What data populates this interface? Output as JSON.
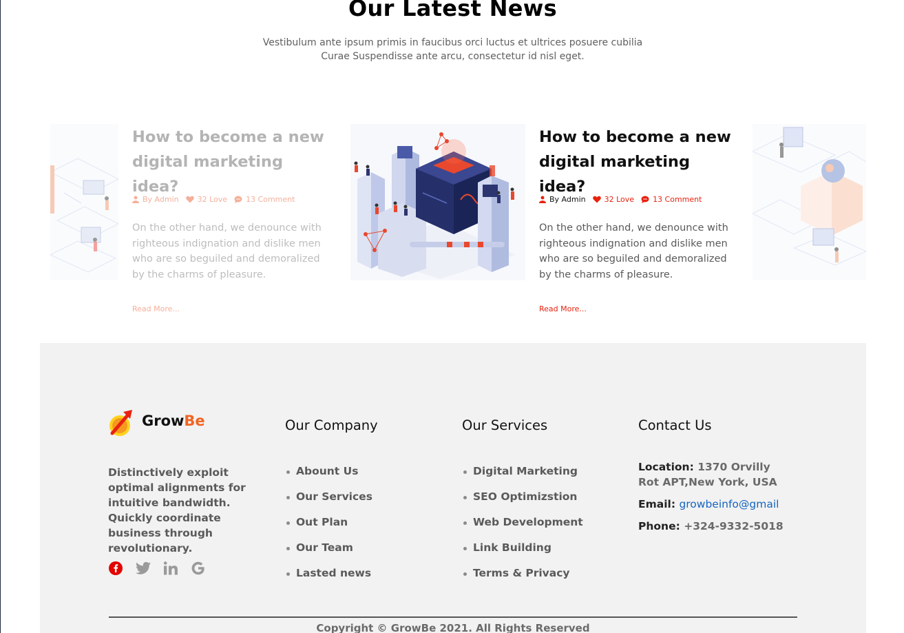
{
  "news": {
    "title": "Our Latest News",
    "subtitle": "Vestibulum ante ipsum primis in faucibus orci luctus et ultrices posuere cubilia Curae Suspendisse ante arcu, consectetur id nisl eget."
  },
  "cards": [
    {
      "title": "How to become a new digital marketing idea?",
      "author": "By Admin",
      "love": "32 Love",
      "comments": "13 Comment",
      "text": "On the other hand, we denounce with righteous indignation and dislike men who are so beguiled and demoralized by the charms of pleasure.",
      "read_more": "Read More..."
    },
    {
      "title": "How to become a new digital marketing idea?",
      "author": "By Admin",
      "love": "32 Love",
      "comments": "13 Comment",
      "text": "On the other hand, we denounce with righteous indignation and dislike men who are so beguiled and demoralized by the charms of pleasure.",
      "read_more": "Read More..."
    }
  ],
  "footer": {
    "brand_grow": "Grow",
    "brand_be": "Be",
    "about": "Distinctively exploit optimal alignments for intuitive bandwidth. Quickly coordinate business through revolutionary.",
    "social": [
      "facebook-icon",
      "twitter-icon",
      "linkedin-icon",
      "google-icon"
    ],
    "company": {
      "heading": "Our Company",
      "items": [
        "Abount Us",
        "Our Services",
        "Out Plan",
        "Our Team",
        "Lasted news"
      ]
    },
    "services": {
      "heading": "Our Services",
      "items": [
        "Digital Marketing",
        "SEO Optimizstion",
        "Web Development",
        "Link Building",
        "Terms & Privacy"
      ]
    },
    "contact": {
      "heading": "Contact Us",
      "location_label": "Location:",
      "location_value": "1370 Orvilly Rot APT,New York, USA",
      "email_label": "Email:",
      "email_value": "growbeinfo@gmail",
      "phone_label": "Phone:",
      "phone_value": "+324-9332-5018"
    },
    "copyright": "Copyright © GrowBe 2021. All Rights Reserved"
  },
  "colors": {
    "accent": "#e8220e",
    "brand_orange": "#f26522",
    "link_blue": "#1565c0",
    "footer_bg": "#f2f2f2"
  }
}
